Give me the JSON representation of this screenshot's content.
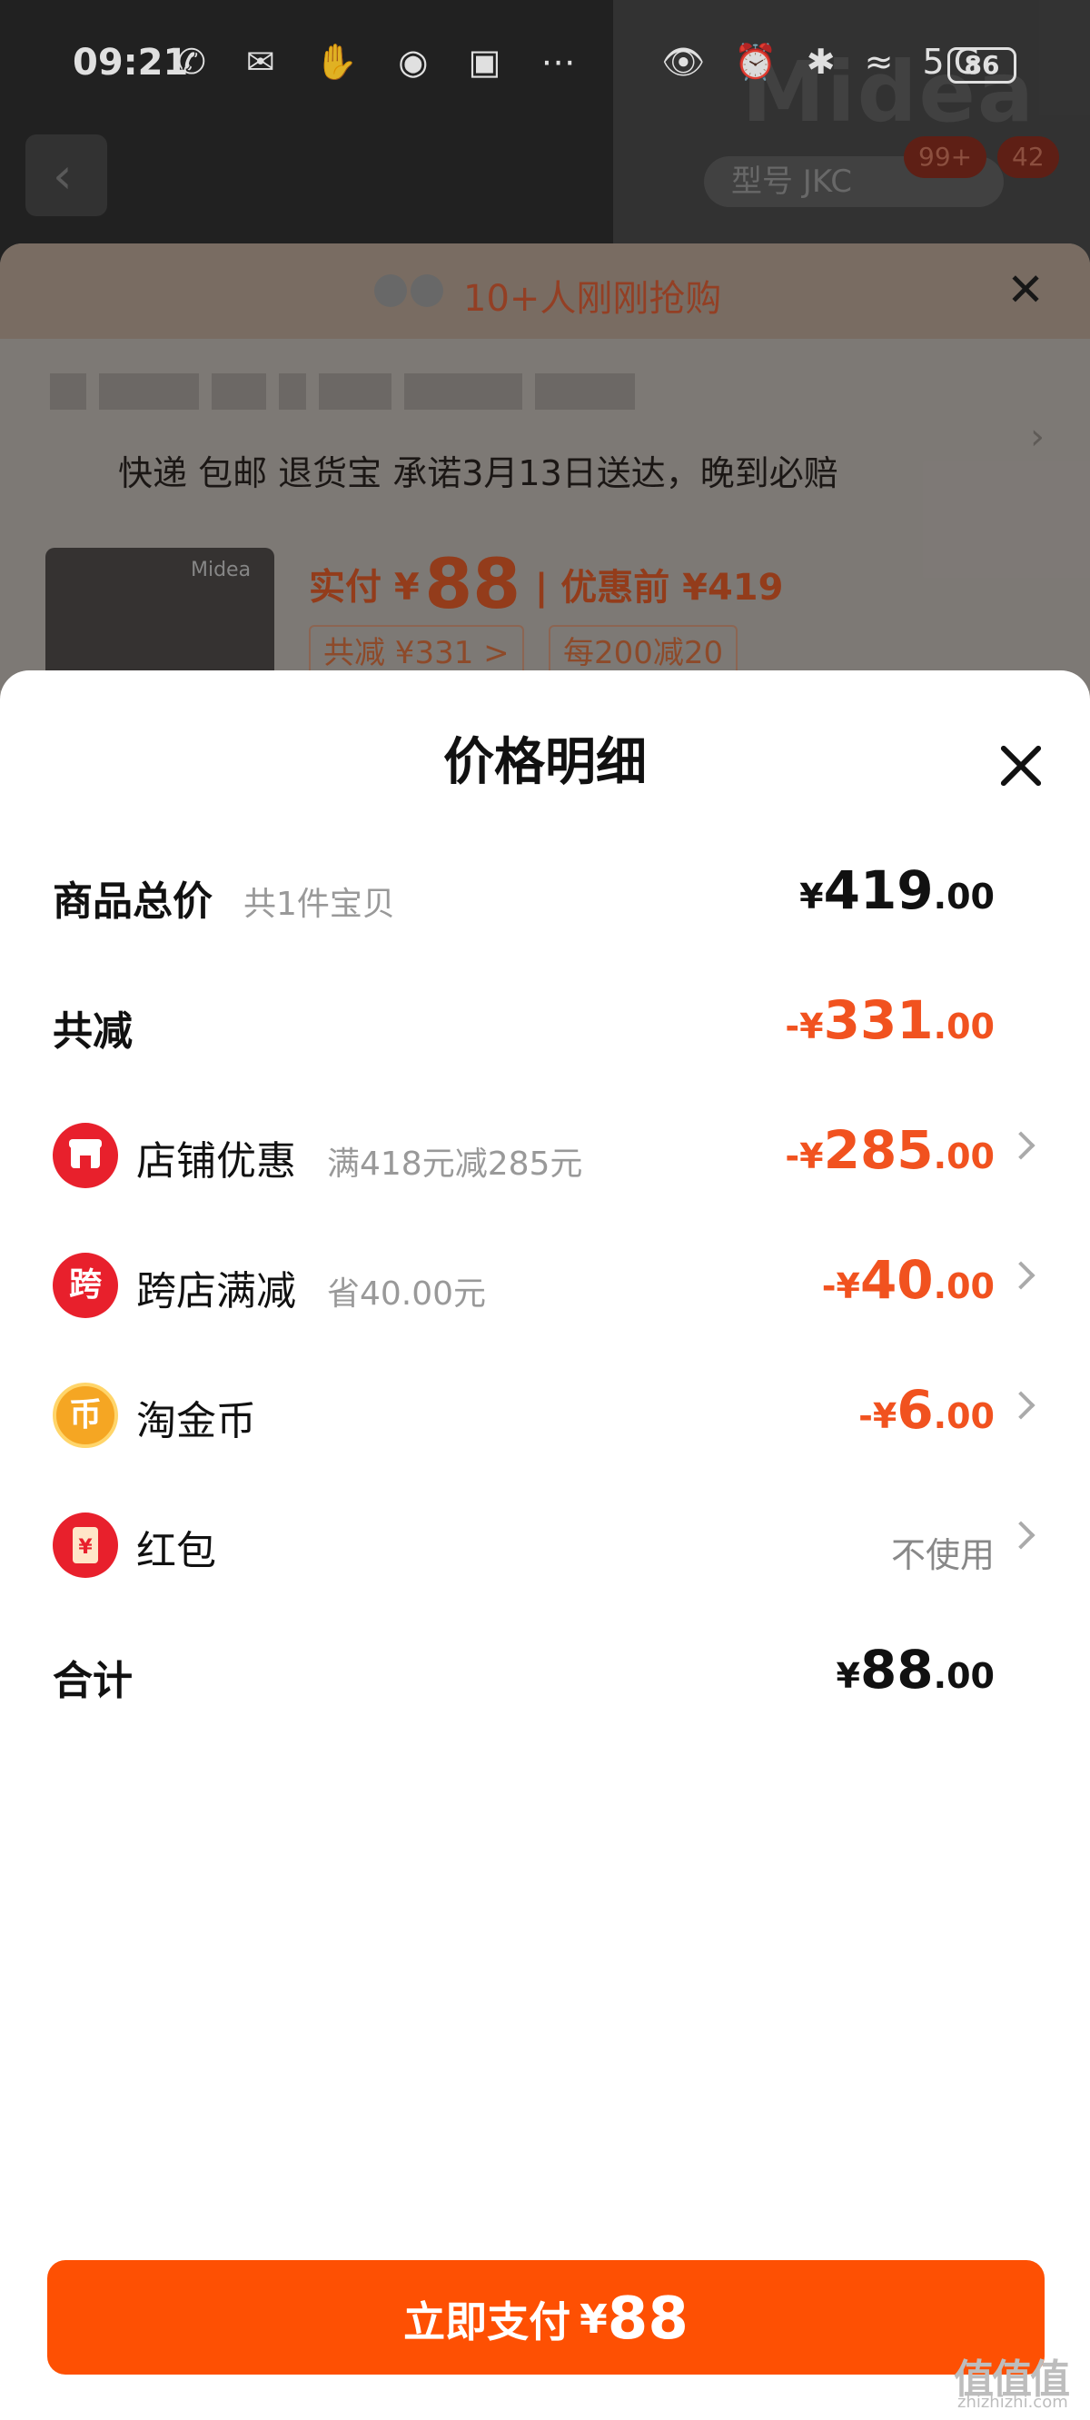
{
  "status_bar": {
    "time": "09:21",
    "icons_left": "✆ ✉ ✋ ◉ ▣ ⋯",
    "icons_right": "👁 ⏰ ✱ ≈ 5G",
    "battery": "86"
  },
  "background": {
    "brand": "Midea",
    "model_pill": "型号 JKC",
    "badge_1": "99+",
    "badge_2": "42",
    "buying_text": "10+人刚刚抢购",
    "shipping": "快递 包邮 退货宝 承诺3月13日送达，晚到必赔",
    "thumb_brand": "Midea",
    "price_label": "实付 ¥",
    "price_value": "88",
    "original_price": "| 优惠前 ¥419",
    "chip_discount": "共减 ¥331 >",
    "chip_promo": "每200减20"
  },
  "panel": {
    "title": "价格明细",
    "rows": {
      "total": {
        "title": "商品总价",
        "sub": "共1件宝贝",
        "prefix": "¥",
        "int": "419",
        "dec": ".00"
      },
      "reduce": {
        "title": "共减",
        "prefix": "-¥",
        "int": "331",
        "dec": ".00"
      },
      "shop": {
        "title": "店铺优惠",
        "sub": "满418元减285元",
        "prefix": "-¥",
        "int": "285",
        "dec": ".00",
        "icon": "store-icon"
      },
      "cross": {
        "title": "跨店满减",
        "sub": "省40.00元",
        "prefix": "-¥",
        "int": "40",
        "dec": ".00",
        "icon_text": "跨"
      },
      "coin": {
        "title": "淘金币",
        "prefix": "-¥",
        "int": "6",
        "dec": ".00",
        "icon_text": "币"
      },
      "redpacket": {
        "title": "红包",
        "value": "不使用",
        "icon_text": "¥"
      },
      "sum": {
        "title": "合计",
        "prefix": "¥",
        "int": "88",
        "dec": ".00"
      }
    }
  },
  "pay_button": {
    "label": "立即支付",
    "currency": "¥",
    "amount": "88"
  },
  "watermark": {
    "main": "值值值",
    "sub": "zhizhizhi.com"
  },
  "colors": {
    "accent": "#fe5003",
    "discount": "#f1521f",
    "icon_red": "#e8202c",
    "icon_gold": "#f5a623"
  }
}
